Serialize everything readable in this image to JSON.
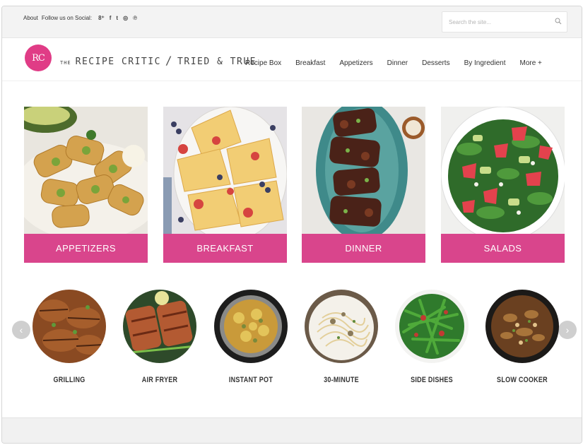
{
  "topbar": {
    "about": "About",
    "follow": "Follow us on Social:",
    "social_icons": [
      "googleplus-icon",
      "facebook-icon",
      "twitter-icon",
      "instagram-icon",
      "pinterest-icon"
    ],
    "social_glyphs": [
      "8⁺",
      "f",
      "t",
      "◎",
      "℗"
    ],
    "search_placeholder": "Search the site..."
  },
  "header": {
    "logo_text": "RC",
    "brand_the": "THE",
    "brand_name": "RECIPE CRITIC",
    "brand_slash": "/",
    "brand_tagline": "TRIED & TRUE",
    "nav": [
      "Recipe Box",
      "Breakfast",
      "Appetizers",
      "Dinner",
      "Desserts",
      "By Ingredient",
      "More +"
    ]
  },
  "categories": [
    {
      "label": "APPETIZERS"
    },
    {
      "label": "BREAKFAST"
    },
    {
      "label": "DINNER"
    },
    {
      "label": "SALADS"
    }
  ],
  "collections": [
    {
      "label": "GRILLING"
    },
    {
      "label": "AIR FRYER"
    },
    {
      "label": "INSTANT POT"
    },
    {
      "label": "30-MINUTE"
    },
    {
      "label": "SIDE DISHES"
    },
    {
      "label": "SLOW COOKER"
    }
  ],
  "carousel": {
    "prev": "‹",
    "next": "›"
  },
  "colors": {
    "brand_pink": "#d9458c",
    "logo_pink": "#e03c86"
  }
}
